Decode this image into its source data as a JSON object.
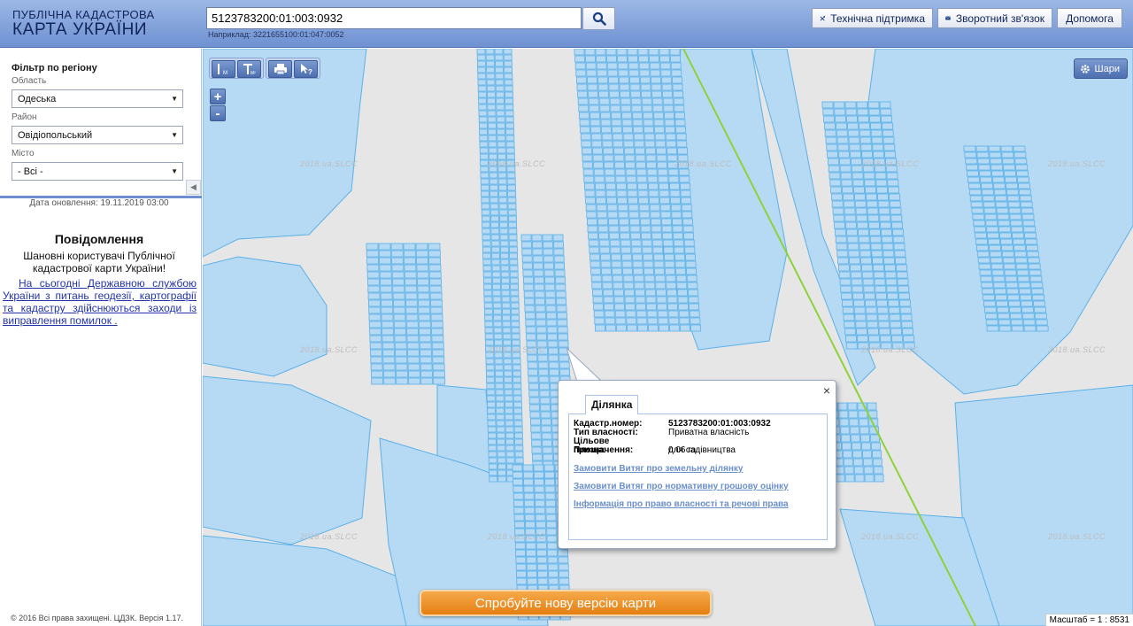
{
  "header": {
    "logo_line1": "ПУБЛІЧНА КАДАСТРОВА",
    "logo_line2": "КАРТА УКРАЇНИ",
    "search_value": "5123783200:01:003:0932",
    "search_hint": "Наприклад: 3221655100:01:047:0052",
    "buttons": {
      "support": "Технічна підтримка",
      "feedback": "Зворотний зв'язок",
      "help": "Допомога"
    }
  },
  "sidebar": {
    "filter_title": "Фільтр по регіону",
    "oblast_label": "Область",
    "oblast_value": "Одеська",
    "raion_label": "Район",
    "raion_value": "Овідіопольський",
    "misto_label": "Місто",
    "misto_value": "- Всі -",
    "update_date": "Дата оновлення: 19.11.2019 03:00",
    "notice_title": "Повідомлення",
    "notice_text": "Шановні користувачі Публічної кадастрової карти України!",
    "notice_link": "На сьогодні Державною службою України з питань геодезії, картографії та кадастру здійснюються заходи із виправлення помилок .",
    "copyright": "© 2016 Всі права захищені. ЦДЗК. Версія 1.17."
  },
  "map": {
    "layers_label": "Шари",
    "watermark": "2018.ua.SLCC",
    "scale_label": "Масштаб = 1 : 8531",
    "try_new_label": "Спробуйте нову версію карти",
    "colors": {
      "background": "#e6e6e6",
      "parcel_fill": "#b7daf4",
      "parcel_stroke": "#5ab0e8",
      "boundary_line": "#8cd23a"
    }
  },
  "popup": {
    "tab_label": "Ділянка",
    "rows": [
      {
        "key": "Кадастр.номер:",
        "value": "5123783200:01:003:0932"
      },
      {
        "key": "Тип власності:",
        "value": "Приватна власність"
      },
      {
        "key": "Цільове призначення:",
        "value": "для садівництва"
      },
      {
        "key": "Площа:",
        "value": "0.06 га"
      }
    ],
    "links": [
      "Замовити Витяг про земельну ділянку",
      "Замовити Витяг про нормативну грошову оцінку",
      "Інформація про право власності та речові права"
    ],
    "close_symbol": "×"
  }
}
